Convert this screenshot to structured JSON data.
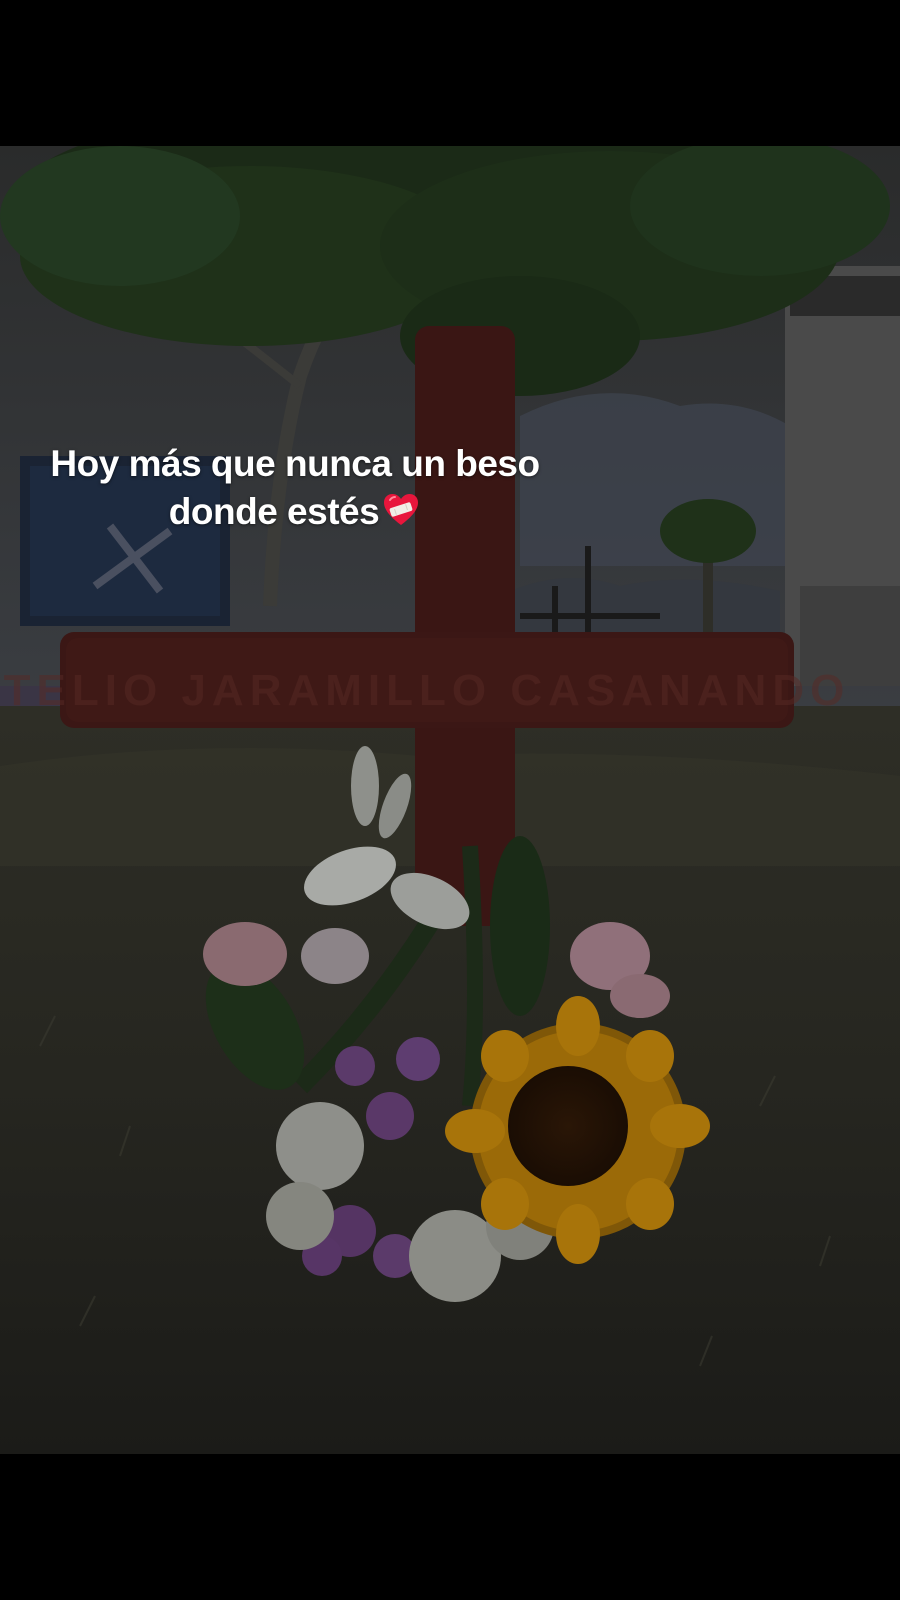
{
  "caption": {
    "line1": "Hoy más que nunca un beso",
    "line2": "donde estés",
    "emoji": "mending-heart-icon"
  },
  "colors": {
    "letterbox": "#000000",
    "heart": "#e8163c",
    "cross": "#3a1614",
    "sunflower": "#9b6a08",
    "grass": "#2a2a22"
  }
}
